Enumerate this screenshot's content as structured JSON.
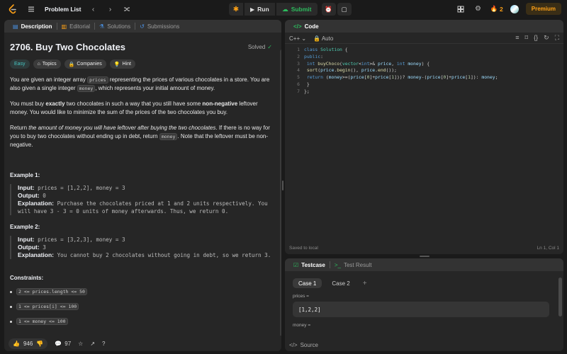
{
  "topbar": {
    "problem_list": "Problem List",
    "run": "Run",
    "submit": "Submit",
    "streak_count": "2",
    "premium": "Premium"
  },
  "left_tabs": [
    {
      "label": "Description",
      "icon": "description-icon"
    },
    {
      "label": "Editorial",
      "icon": "book-icon"
    },
    {
      "label": "Solutions",
      "icon": "flask-icon"
    },
    {
      "label": "Submissions",
      "icon": "history-icon"
    }
  ],
  "problem": {
    "title": "2706. Buy Two Chocolates",
    "status": "Solved",
    "tags": {
      "easy": "Easy",
      "topics": "Topics",
      "companies": "Companies",
      "hint": "Hint"
    },
    "p1": {
      "a": "You are given an integer array ",
      "code1": "prices",
      "b": " representing the prices of various chocolates in a store. You are also given a single integer ",
      "code2": "money",
      "c": ", which represents your initial amount of money."
    },
    "p2": {
      "a": "You must buy ",
      "strong1": "exactly",
      "b": " two chocolates in such a way that you still have some ",
      "strong2": "non-negative",
      "c": " leftover money. You would like to minimize the sum of the prices of the two chocolates you buy."
    },
    "p3": {
      "a": "Return ",
      "em": "the amount of money you will have leftover after buying the two chocolates",
      "b": ". If there is no way for you to buy two chocolates without ending up in debt, return ",
      "code": "money",
      "c": ". Note that the leftover must be non-negative."
    },
    "examples": [
      {
        "title": "Example 1:",
        "input_label": "Input:",
        "input": " prices = [1,2,2], money = 3",
        "output_label": "Output:",
        "output": " 0",
        "explanation_label": "Explanation:",
        "explanation": " Purchase the chocolates priced at 1 and 2 units respectively. You will have 3 - 3 = 0 units of money afterwards. Thus, we return 0."
      },
      {
        "title": "Example 2:",
        "input_label": "Input:",
        "input": " prices = [3,2,3], money = 3",
        "output_label": "Output:",
        "output": " 3",
        "explanation_label": "Explanation:",
        "explanation": " You cannot buy 2 chocolates without going in debt, so we return 3."
      }
    ],
    "constraints_title": "Constraints:",
    "constraints": [
      "2 <= prices.length <= 50",
      "1 <= prices[i] <= 100",
      "1 <= money <= 100"
    ]
  },
  "left_footer": {
    "likes": "946",
    "comments": "97"
  },
  "code_panel": {
    "title": "Code",
    "language": "C++",
    "auto": "Auto",
    "status": "Saved to local",
    "cursor": "Ln 1, Col 1"
  },
  "test_panel": {
    "tab_testcase": "Testcase",
    "tab_result": "Test Result",
    "case1": "Case 1",
    "case2": "Case 2",
    "prices_label": "prices =",
    "prices_value": "[1,2,2]",
    "money_label": "money =",
    "source": "Source"
  },
  "colors": {
    "accent": "#ffa116",
    "submit": "#2cbb5d",
    "easy": "#46c6c2",
    "bg": "#1a1a1a",
    "panel": "#262626"
  }
}
